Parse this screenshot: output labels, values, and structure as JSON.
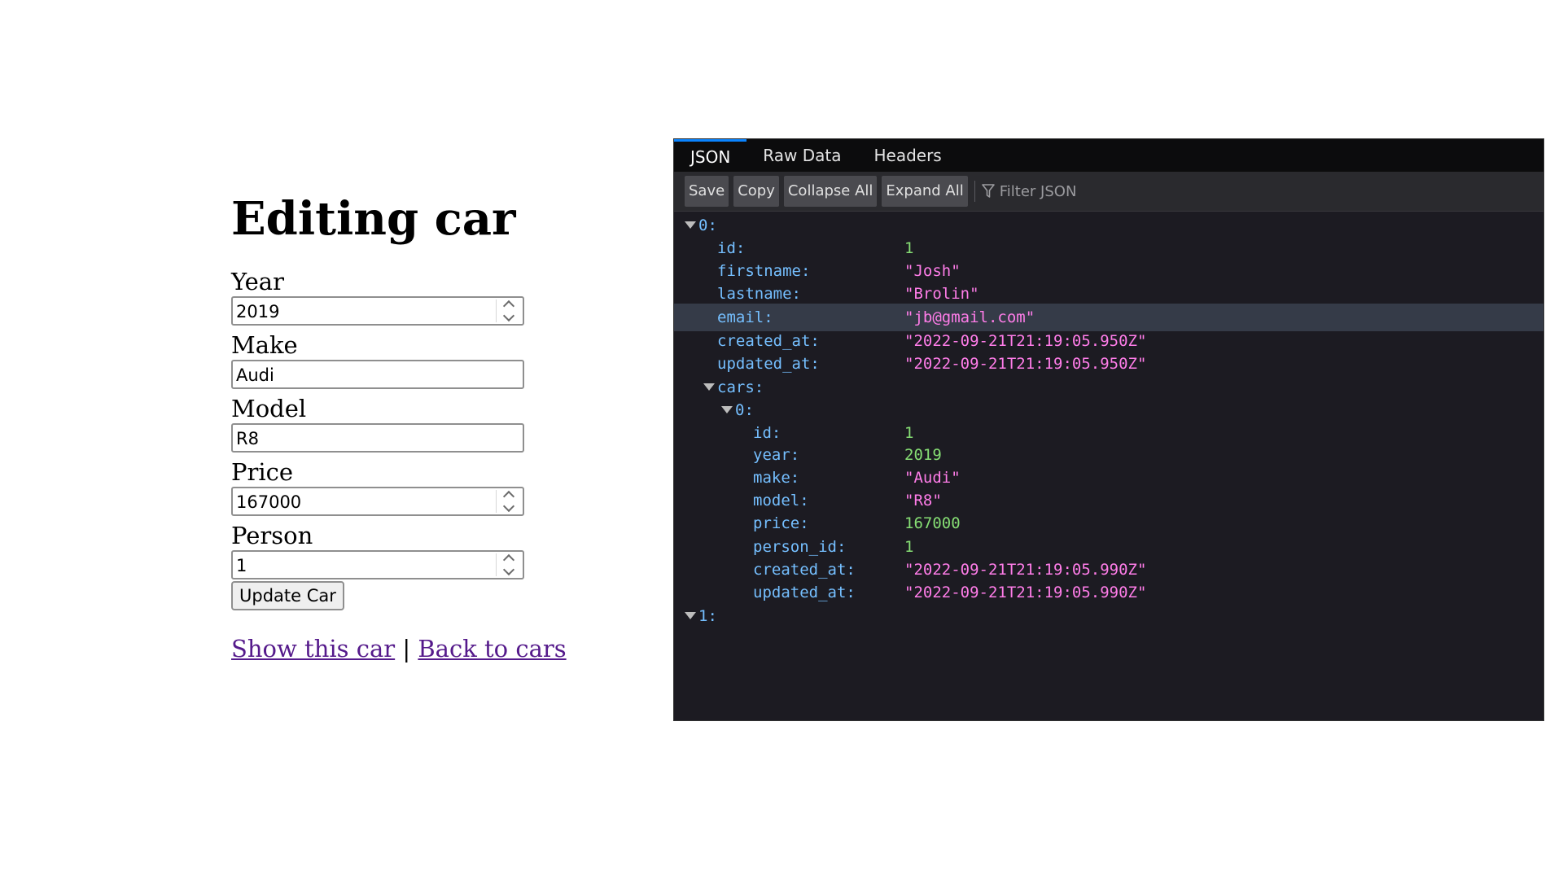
{
  "form": {
    "title": "Editing car",
    "fields": [
      {
        "label": "Year",
        "value": "2019",
        "type": "number"
      },
      {
        "label": "Make",
        "value": "Audi",
        "type": "text"
      },
      {
        "label": "Model",
        "value": "R8",
        "type": "text"
      },
      {
        "label": "Price",
        "value": "167000",
        "type": "number"
      },
      {
        "label": "Person",
        "value": "1",
        "type": "number"
      }
    ],
    "submit_label": "Update Car",
    "show_link": "Show this car",
    "separator": "|",
    "back_link": "Back to cars"
  },
  "viewer": {
    "tabs": [
      "JSON",
      "Raw Data",
      "Headers"
    ],
    "active_tab": "JSON",
    "toolbar": [
      "Save",
      "Copy",
      "Collapse All",
      "Expand All"
    ],
    "filter_placeholder": "Filter JSON",
    "filter_icon": "funnel-icon",
    "tree": [
      {
        "key": "0:",
        "expanded": true
      },
      {
        "key": "id:",
        "value": "1",
        "kind": "num"
      },
      {
        "key": "firstname:",
        "value": "\"Josh\"",
        "kind": "str"
      },
      {
        "key": "lastname:",
        "value": "\"Brolin\"",
        "kind": "str"
      },
      {
        "key": "email:",
        "value": "\"jb@gmail.com\"",
        "kind": "str",
        "highlighted": true
      },
      {
        "key": "created_at:",
        "value": "\"2022-09-21T21:19:05.950Z\"",
        "kind": "str"
      },
      {
        "key": "updated_at:",
        "value": "\"2022-09-21T21:19:05.950Z\"",
        "kind": "str"
      },
      {
        "key": "cars:",
        "expanded": true
      },
      {
        "key": "0:",
        "expanded": true
      },
      {
        "key": "id:",
        "value": "1",
        "kind": "num"
      },
      {
        "key": "year:",
        "value": "2019",
        "kind": "num"
      },
      {
        "key": "make:",
        "value": "\"Audi\"",
        "kind": "str"
      },
      {
        "key": "model:",
        "value": "\"R8\"",
        "kind": "str"
      },
      {
        "key": "price:",
        "value": "167000",
        "kind": "num"
      },
      {
        "key": "person_id:",
        "value": "1",
        "kind": "num"
      },
      {
        "key": "created_at:",
        "value": "\"2022-09-21T21:19:05.990Z\"",
        "kind": "str"
      },
      {
        "key": "updated_at:",
        "value": "\"2022-09-21T21:19:05.990Z\"",
        "kind": "str"
      },
      {
        "key": "1:",
        "expanded": true
      }
    ]
  },
  "colors": {
    "key": "#75bfff",
    "string": "#ff7de9",
    "number": "#86de74",
    "link": "#551a8b",
    "viewer_bg": "#1c1b22"
  }
}
